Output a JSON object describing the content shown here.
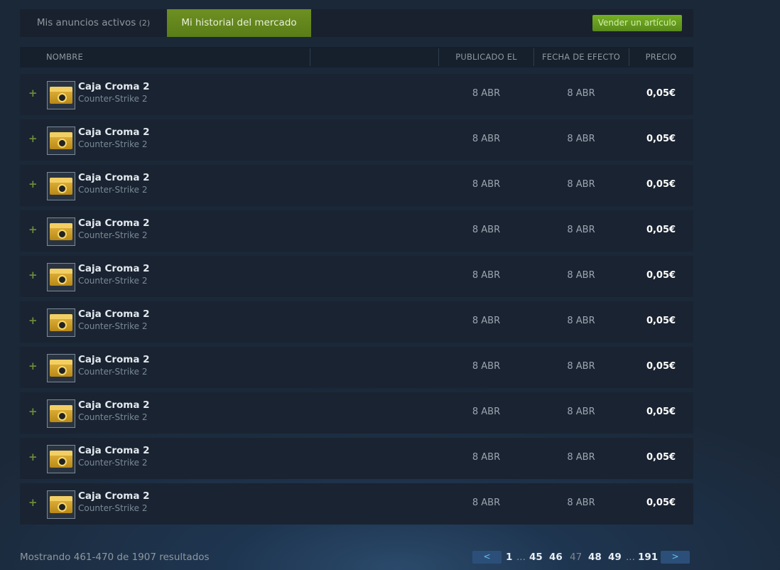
{
  "tabs": {
    "active_listings_label": "Mis anuncios activos",
    "active_listings_count": "(2)",
    "history_label": "Mi historial del mercado",
    "sell_button": "Vender un artículo"
  },
  "table": {
    "headers": {
      "name": "NOMBRE",
      "published": "PUBLICADO EL",
      "effective": "FECHA DE EFECTO",
      "price": "PRECIO"
    },
    "rows": [
      {
        "expand": "+",
        "name": "Caja Croma 2",
        "game": "Counter-Strike 2",
        "published": "8 ABR",
        "effective": "8 ABR",
        "price": "0,05€",
        "icon": "case-icon"
      },
      {
        "expand": "+",
        "name": "Caja Croma 2",
        "game": "Counter-Strike 2",
        "published": "8 ABR",
        "effective": "8 ABR",
        "price": "0,05€",
        "icon": "case-icon"
      },
      {
        "expand": "+",
        "name": "Caja Croma 2",
        "game": "Counter-Strike 2",
        "published": "8 ABR",
        "effective": "8 ABR",
        "price": "0,05€",
        "icon": "case-icon"
      },
      {
        "expand": "+",
        "name": "Caja Croma 2",
        "game": "Counter-Strike 2",
        "published": "8 ABR",
        "effective": "8 ABR",
        "price": "0,05€",
        "icon": "case-icon"
      },
      {
        "expand": "+",
        "name": "Caja Croma 2",
        "game": "Counter-Strike 2",
        "published": "8 ABR",
        "effective": "8 ABR",
        "price": "0,05€",
        "icon": "case-icon"
      },
      {
        "expand": "+",
        "name": "Caja Croma 2",
        "game": "Counter-Strike 2",
        "published": "8 ABR",
        "effective": "8 ABR",
        "price": "0,05€",
        "icon": "case-icon"
      },
      {
        "expand": "+",
        "name": "Caja Croma 2",
        "game": "Counter-Strike 2",
        "published": "8 ABR",
        "effective": "8 ABR",
        "price": "0,05€",
        "icon": "case-icon"
      },
      {
        "expand": "+",
        "name": "Caja Croma 2",
        "game": "Counter-Strike 2",
        "published": "8 ABR",
        "effective": "8 ABR",
        "price": "0,05€",
        "icon": "case-icon"
      },
      {
        "expand": "+",
        "name": "Caja Croma 2",
        "game": "Counter-Strike 2",
        "published": "8 ABR",
        "effective": "8 ABR",
        "price": "0,05€",
        "icon": "case-icon"
      },
      {
        "expand": "+",
        "name": "Caja Croma 2",
        "game": "Counter-Strike 2",
        "published": "8 ABR",
        "effective": "8 ABR",
        "price": "0,05€",
        "icon": "case-icon"
      }
    ]
  },
  "footer": {
    "results_text": "Mostrando 461-470 de 1907 resultados"
  },
  "pagination": {
    "prev": "<",
    "next": ">",
    "pages": [
      "1",
      "...",
      "45",
      "46",
      "47",
      "48",
      "49",
      "...",
      "191"
    ],
    "current": "47"
  },
  "colors": {
    "accent_green": "#5c7e10",
    "background": "#1b2838",
    "link_blue": "#66c0f4"
  }
}
